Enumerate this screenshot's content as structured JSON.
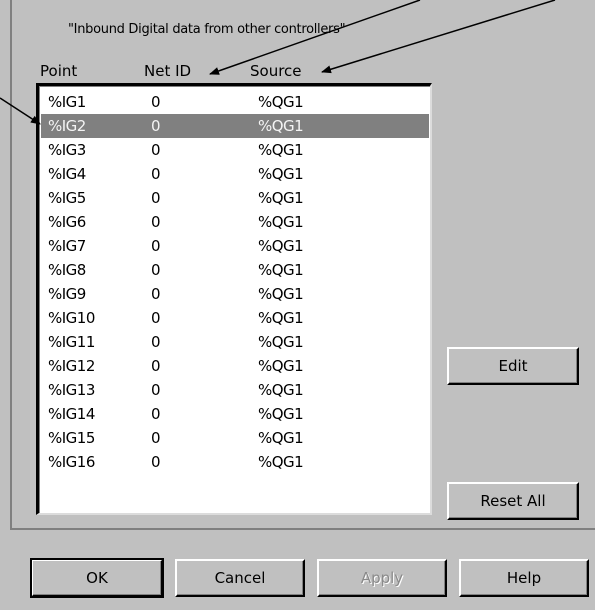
{
  "dialog": {
    "subtitle": "\"Inbound Digital data from other controllers\""
  },
  "list": {
    "headers": {
      "point": "Point",
      "net_id": "Net ID",
      "source": "Source"
    },
    "rows": [
      {
        "point": "%IG1",
        "net_id": "0",
        "source": "%QG1"
      },
      {
        "point": "%IG2",
        "net_id": "0",
        "source": "%QG1"
      },
      {
        "point": "%IG3",
        "net_id": "0",
        "source": "%QG1"
      },
      {
        "point": "%IG4",
        "net_id": "0",
        "source": "%QG1"
      },
      {
        "point": "%IG5",
        "net_id": "0",
        "source": "%QG1"
      },
      {
        "point": "%IG6",
        "net_id": "0",
        "source": "%QG1"
      },
      {
        "point": "%IG7",
        "net_id": "0",
        "source": "%QG1"
      },
      {
        "point": "%IG8",
        "net_id": "0",
        "source": "%QG1"
      },
      {
        "point": "%IG9",
        "net_id": "0",
        "source": "%QG1"
      },
      {
        "point": "%IG10",
        "net_id": "0",
        "source": "%QG1"
      },
      {
        "point": "%IG11",
        "net_id": "0",
        "source": "%QG1"
      },
      {
        "point": "%IG12",
        "net_id": "0",
        "source": "%QG1"
      },
      {
        "point": "%IG13",
        "net_id": "0",
        "source": "%QG1"
      },
      {
        "point": "%IG14",
        "net_id": "0",
        "source": "%QG1"
      },
      {
        "point": "%IG15",
        "net_id": "0",
        "source": "%QG1"
      },
      {
        "point": "%IG16",
        "net_id": "0",
        "source": "%QG1"
      }
    ],
    "selected_row": "%IG2"
  },
  "buttons": {
    "edit": "Edit",
    "reset_all": "Reset All",
    "ok": "OK",
    "cancel": "Cancel",
    "apply": "Apply",
    "help": "Help"
  },
  "colors": {
    "dialog_bg": "#c0c0c0",
    "selection_bg": "#808080"
  }
}
